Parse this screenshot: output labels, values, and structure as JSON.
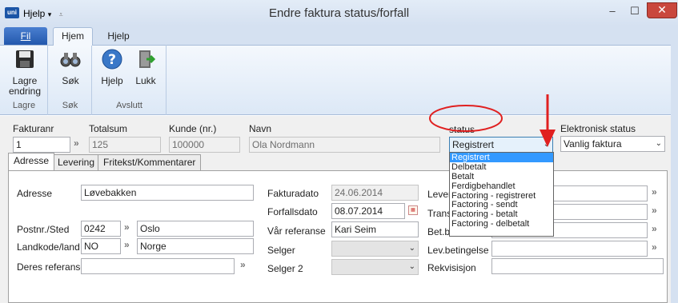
{
  "app": {
    "quick_menu": "Hjelp",
    "quick_menu_arrow": "▾",
    "quick_menu_extra": "⩡",
    "title": "Endre faktura status/forfall",
    "minimize": "–",
    "maximize": "☐",
    "close": "✕",
    "logo_text": "uni"
  },
  "menu_tabs": [
    {
      "label": "Fil"
    },
    {
      "label": "Hjem"
    },
    {
      "label": "Hjelp"
    }
  ],
  "ribbon": {
    "groups": [
      {
        "label": "Lagre",
        "buttons": [
          {
            "label1": "Lagre",
            "label2": "endring",
            "icon": "floppy-disk-icon"
          }
        ]
      },
      {
        "label": "Søk",
        "buttons": [
          {
            "label1": "Søk",
            "icon": "binoculars-icon"
          }
        ]
      },
      {
        "label": "Avslutt",
        "buttons": [
          {
            "label1": "Hjelp",
            "icon": "help-icon"
          },
          {
            "label1": "Lukk",
            "icon": "exit-door-icon"
          }
        ]
      }
    ]
  },
  "header": {
    "fakturanr": {
      "label": "Fakturanr",
      "value": "1"
    },
    "totalsum": {
      "label": "Totalsum",
      "value": "125"
    },
    "kunde": {
      "label": "Kunde (nr.)",
      "value": "100000"
    },
    "navn": {
      "label": "Navn",
      "value": "Ola Nordmann"
    },
    "status": {
      "label": "status",
      "value": "Registrert"
    },
    "elektronisk": {
      "label": "Elektronisk status",
      "value": "Vanlig faktura"
    },
    "chevron": "»"
  },
  "detail_tabs": [
    {
      "label": "Adresse"
    },
    {
      "label": "Levering"
    },
    {
      "label": "Fritekst/Kommentarer"
    }
  ],
  "address": {
    "adresse_label": "Adresse",
    "adresse_value": "Løvebakken",
    "postnr_label": "Postnr./Sted",
    "postnr_value": "0242",
    "sted_value": "Oslo",
    "land_label": "Landkode/land",
    "landkode_value": "NO",
    "land_value": "Norge",
    "ref_label": "Deres referanse",
    "ref_value": ""
  },
  "invoice": {
    "fakturadato_label": "Fakturadato",
    "fakturadato_value": "24.06.2014",
    "forfall_label": "Forfallsdato",
    "forfall_value": "08.07.2014",
    "var_ref_label": "Vår referanse",
    "var_ref_value": "Kari Seim",
    "selger_label": "Selger",
    "selger2_label": "Selger 2"
  },
  "right": {
    "lever_label": "Lever",
    "trans_label": "Trans",
    "betbe_label": "Bet.be",
    "levbet_label": "Lev.betingelse",
    "rekv_label": "Rekvisisjon"
  },
  "status_options": [
    {
      "label": "Registrert",
      "selected": true
    },
    {
      "label": "Delbetalt"
    },
    {
      "label": "Betalt"
    },
    {
      "label": "Ferdigbehandlet"
    },
    {
      "label": "Factoring - registreret"
    },
    {
      "label": "Factoring - sendt"
    },
    {
      "label": "Factoring - betalt"
    },
    {
      "label": "Factoring - delbetalt"
    }
  ],
  "colors": {
    "annotation_red": "#e02020",
    "ribbon_blue": "#d5e1f1",
    "selection_blue": "#3399ff"
  }
}
